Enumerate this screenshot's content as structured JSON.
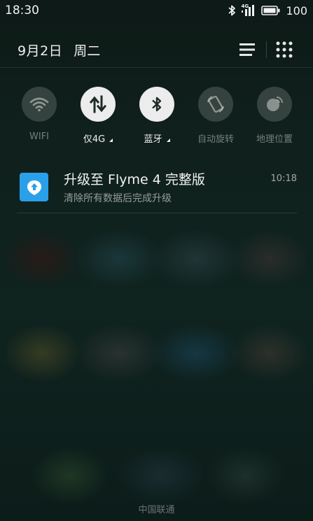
{
  "status_bar": {
    "time": "18:30",
    "network_label": "4G",
    "battery": "100"
  },
  "header": {
    "date": "9月2日",
    "weekday": "周二"
  },
  "toggles": [
    {
      "label": "WIFI",
      "state": "off",
      "icon": "wifi-icon"
    },
    {
      "label": "仅4G",
      "state": "on",
      "icon": "mobile-data-icon",
      "has_dropdown": true
    },
    {
      "label": "蓝牙",
      "state": "on",
      "icon": "bluetooth-icon",
      "has_dropdown": true
    },
    {
      "label": "自动旋转",
      "state": "off",
      "icon": "auto-rotate-icon"
    },
    {
      "label": "地理位置",
      "state": "off",
      "icon": "location-icon"
    }
  ],
  "notification": {
    "title": "升级至 Flyme 4 完整版",
    "subtitle": "清除所有数据后完成升级",
    "time": "10:18",
    "icon": "upgrade-icon",
    "icon_color": "#2ba0ea"
  },
  "carrier": "中国联通"
}
